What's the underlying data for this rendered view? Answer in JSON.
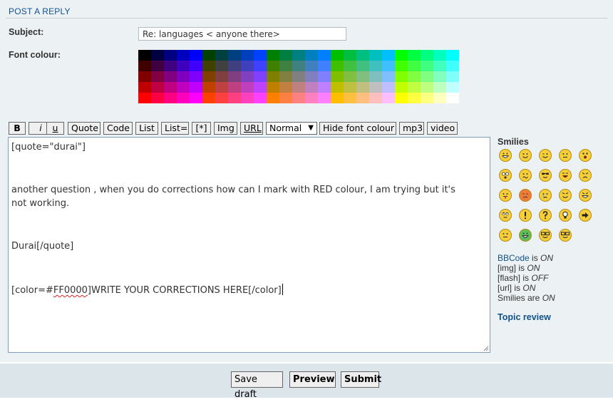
{
  "panel": {
    "title": "POST A REPLY"
  },
  "form": {
    "subject_label": "Subject:",
    "subject_value": "Re: languages < anyone there>",
    "font_colour_label": "Font colour:"
  },
  "palette": {
    "rows": [
      [
        "#000000",
        "#000040",
        "#000080",
        "#0000BF",
        "#0000FF",
        "#004000",
        "#004040",
        "#004080",
        "#0040BF",
        "#0040FF",
        "#008000",
        "#008040",
        "#008080",
        "#0080BF",
        "#0080FF",
        "#00BF00",
        "#00BF40",
        "#00BF80",
        "#00BFBF",
        "#00BFFF",
        "#00FF00",
        "#00FF40",
        "#00FF80",
        "#00FFBF",
        "#00FFFF"
      ],
      [
        "#400000",
        "#400040",
        "#400080",
        "#4000BF",
        "#4000FF",
        "#404000",
        "#404040",
        "#404080",
        "#4040BF",
        "#4040FF",
        "#408000",
        "#408040",
        "#408080",
        "#4080BF",
        "#4080FF",
        "#40BF00",
        "#40BF40",
        "#40BF80",
        "#40BFBF",
        "#40BFFF",
        "#40FF00",
        "#40FF40",
        "#40FF80",
        "#40FFBF",
        "#40FFFF"
      ],
      [
        "#800000",
        "#800040",
        "#800080",
        "#8000BF",
        "#8000FF",
        "#804000",
        "#804040",
        "#804080",
        "#8040BF",
        "#8040FF",
        "#808000",
        "#808040",
        "#808080",
        "#8080BF",
        "#8080FF",
        "#80BF00",
        "#80BF40",
        "#80BF80",
        "#80BFBF",
        "#80BFFF",
        "#80FF00",
        "#80FF40",
        "#80FF80",
        "#80FFBF",
        "#80FFFF"
      ],
      [
        "#BF0000",
        "#BF0040",
        "#BF0080",
        "#BF00BF",
        "#BF00FF",
        "#BF4000",
        "#BF4040",
        "#BF4080",
        "#BF40BF",
        "#BF40FF",
        "#BF8000",
        "#BF8040",
        "#BF8080",
        "#BF80BF",
        "#BF80FF",
        "#BFBF00",
        "#BFBF40",
        "#BFBF80",
        "#BFBFBF",
        "#BFBFFF",
        "#BFFF00",
        "#BFFF40",
        "#BFFF80",
        "#BFFFBF",
        "#BFFFFF"
      ],
      [
        "#FF0000",
        "#FF0040",
        "#FF0080",
        "#FF00BF",
        "#FF00FF",
        "#FF4000",
        "#FF4040",
        "#FF4080",
        "#FF40BF",
        "#FF40FF",
        "#FF8000",
        "#FF8040",
        "#FF8080",
        "#FF80BF",
        "#FF80FF",
        "#FFBF00",
        "#FFBF40",
        "#FFBF80",
        "#FFBFBF",
        "#FFBFFF",
        "#FFFF00",
        "#FFFF40",
        "#FFFF80",
        "#FFFFBF",
        "#FFFFFF"
      ]
    ]
  },
  "toolbar": {
    "bold": "B",
    "italic": "i",
    "underline": "u",
    "quote": "Quote",
    "code": "Code",
    "list": "List",
    "list_eq": "List=",
    "list_item": "[*]",
    "img": "Img",
    "url": "URL",
    "font_size": "Normal",
    "hide_colour": "Hide font colour",
    "mp3": "mp3",
    "video": "video"
  },
  "editor": {
    "l1": "[quote=\"durai\"]",
    "l2": "another question , when you do corrections how can I mark with RED colour, I am trying but it's",
    "l3": "not working.",
    "l4": "Durai[/quote]",
    "l5a": "[color=#",
    "l5b": "FF0000",
    "l5c": "]WRITE YOUR CORRECTIONS HERE[/color]"
  },
  "smilies": {
    "title": "Smilies",
    "icons": [
      "biggrin-smiley-icon",
      "smile-smiley-icon",
      "wink-smiley-icon",
      "neutral-smiley-icon",
      "surprised-smiley-icon",
      "eek-smiley-icon",
      "confused-smiley-icon",
      "cool-smiley-icon",
      "lol-smiley-icon",
      "mad-smiley-icon",
      "razz-smiley-icon",
      "red-face-smiley-icon",
      "cry-smiley-icon",
      "evil-smiley-icon",
      "twisted-smiley-icon",
      "rolleyes-smiley-icon",
      "exclaim-smiley-icon",
      "question-smiley-icon",
      "idea-smiley-icon",
      "arrow-smiley-icon",
      "neutral2-smiley-icon",
      "green-grin-smiley-icon",
      "geek-smiley-icon",
      "ugeek-smiley-icon"
    ]
  },
  "status": {
    "bbcode_link": "BBCode",
    "is": " is ",
    "are": " are ",
    "on": "ON",
    "off": "OFF",
    "img": "[img]",
    "flash": "[flash]",
    "url": "[url]",
    "smilies": "Smilies"
  },
  "topic_review": "Topic review",
  "footer": {
    "save_draft": "Save draft",
    "preview": "Preview",
    "submit": "Submit"
  }
}
